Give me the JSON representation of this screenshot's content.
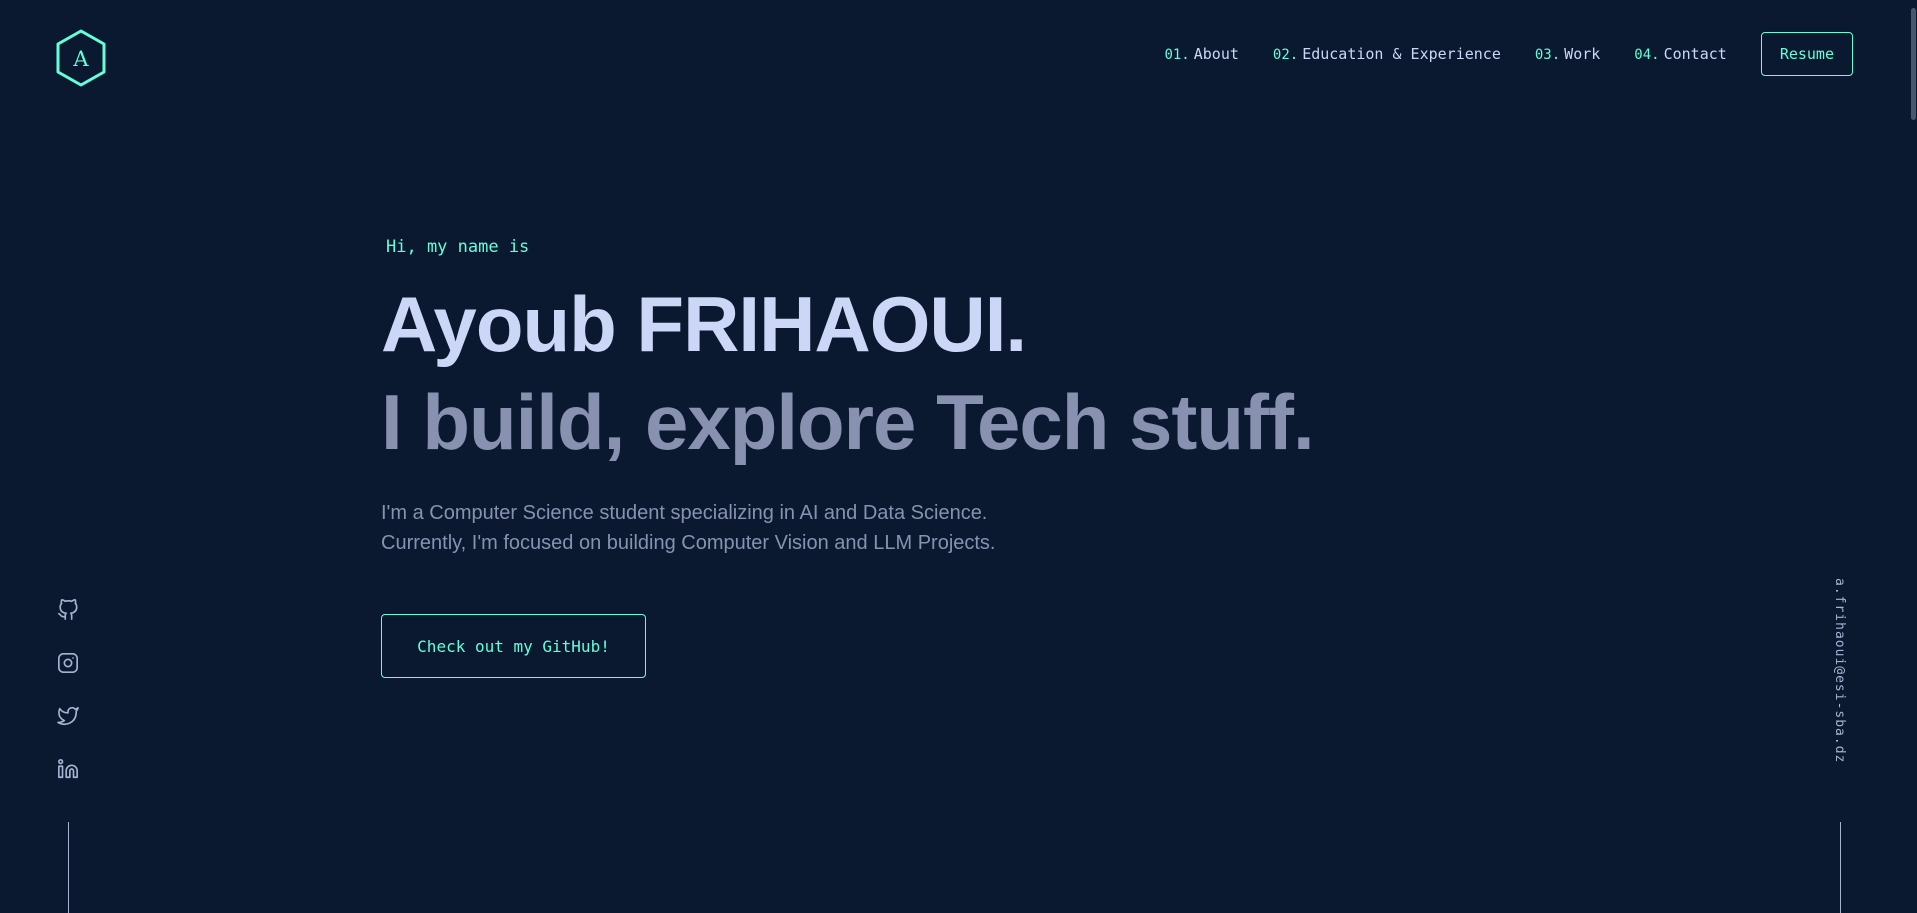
{
  "header": {
    "logo_letter": "A",
    "nav": [
      {
        "num": "01.",
        "label": "About"
      },
      {
        "num": "02.",
        "label": "Education & Experience"
      },
      {
        "num": "03.",
        "label": "Work"
      },
      {
        "num": "04.",
        "label": "Contact"
      }
    ],
    "resume_label": "Resume"
  },
  "hero": {
    "intro": "Hi, my name is",
    "name": "Ayoub FRIHAOUI.",
    "tagline": "I build, explore Tech stuff.",
    "description": [
      "I'm a Computer Science student specializing in AI and Data Science.",
      "Currently, I'm focused on building Computer Vision and LLM Projects."
    ],
    "cta_label": "Check out my GitHub!"
  },
  "socials": [
    {
      "icon": "github-icon"
    },
    {
      "icon": "instagram-icon"
    },
    {
      "icon": "twitter-icon"
    },
    {
      "icon": "linkedin-icon"
    }
  ],
  "email": "a.frihaoui@esi-sba.dz",
  "colors": {
    "background": "#0a192f",
    "accent": "#64ffda",
    "heading": "#ccd6f6",
    "muted": "#8892b0"
  }
}
